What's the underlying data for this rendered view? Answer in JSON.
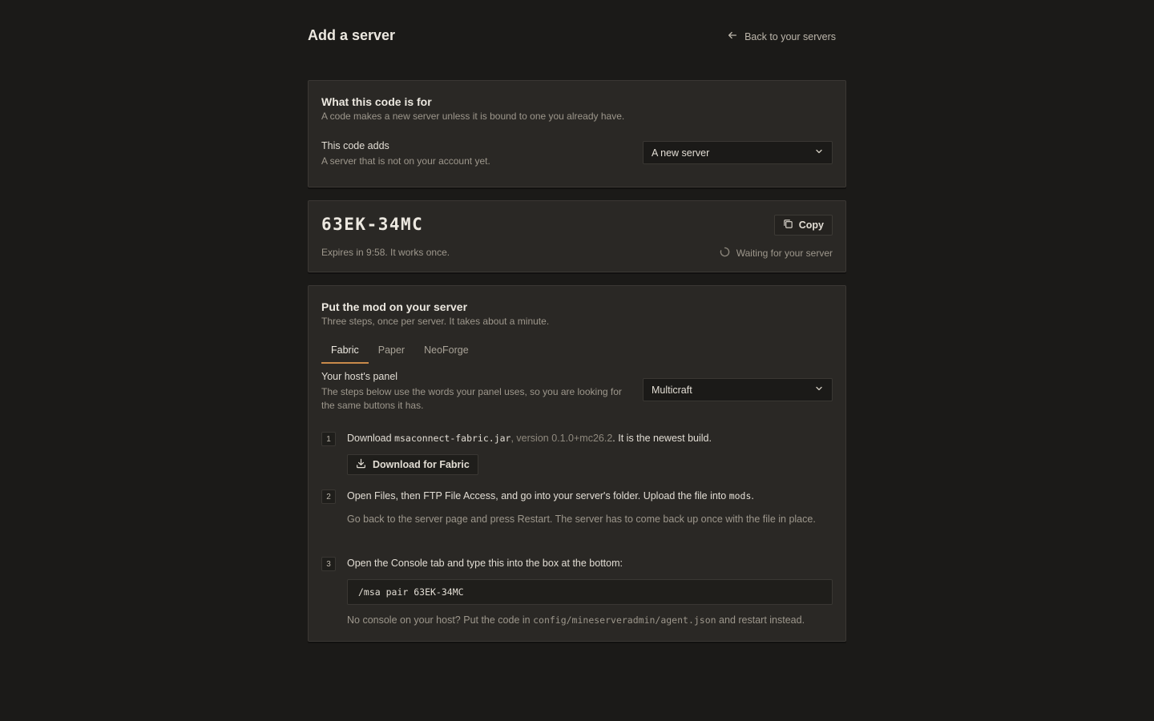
{
  "header": {
    "title": "Add a server",
    "back_label": "Back to your servers"
  },
  "purpose": {
    "title": "What this code is for",
    "subtitle": "A code makes a new server unless it is bound to one you already have.",
    "field_label": "This code adds",
    "field_help": "A server that is not on your account yet.",
    "selected": "A new server"
  },
  "code": {
    "value": "63EK-34MC",
    "copy_label": "Copy",
    "expires": "Expires in 9:58. It works once.",
    "status": "Waiting for your server"
  },
  "install": {
    "title": "Put the mod on your server",
    "subtitle": "Three steps, once per server. It takes about a minute.",
    "tabs": [
      "Fabric",
      "Paper",
      "NeoForge"
    ],
    "active_tab": "Fabric",
    "panel_label": "Your host's panel",
    "panel_help": "The steps below use the words your panel uses, so you are looking for the same buttons it has.",
    "panel_selected": "Multicraft",
    "steps": [
      {
        "num": "1",
        "pre": "Download ",
        "file": "msaconnect-fabric.jar",
        "version": ", version 0.1.0+mc26.2",
        "post": ". It is the newest build.",
        "button": "Download for Fabric"
      },
      {
        "num": "2",
        "pre": "Open Files, then FTP File Access, and go into your server's folder. Upload the file into ",
        "folder": "mods",
        "post": ".",
        "note": "Go back to the server page and press Restart. The server has to come back up once with the file in place."
      },
      {
        "num": "3",
        "text": "Open the Console tab and type this into the box at the bottom:",
        "command": "/msa pair 63EK-34MC",
        "note_pre": "No console on your host? Put the code in ",
        "note_path": "config/mineserveradmin/agent.json",
        "note_post": " and restart instead."
      }
    ]
  },
  "colors": {
    "background": "#1b1a18",
    "card": "#2a2825",
    "accent": "#c98a4a"
  },
  "icons": [
    "arrow-left-icon",
    "chevron-down-icon",
    "copy-icon",
    "spinner-icon",
    "download-icon"
  ]
}
